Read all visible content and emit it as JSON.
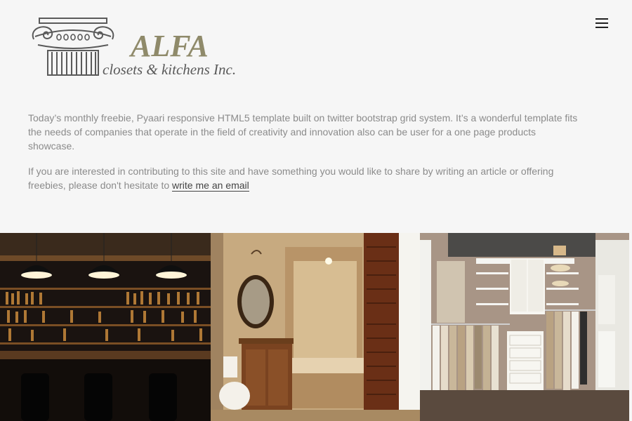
{
  "header": {
    "logo": {
      "brand": "ALFA",
      "tagline": "closets & kitchens Inc.",
      "icon": "ionic-column-icon"
    },
    "menu_icon": "hamburger-menu-icon"
  },
  "intro": {
    "paragraph1": "Today’s monthly freebie, Pyaari responsive HTML5 template built on twitter bootstrap grid system. It’s a wonderful template fits the needs of companies that operate in the field of creativity and innovation also can be user for a one page products showcase.",
    "paragraph2_text": "If you are interested in contributing to this site and have something you would like to share by writing an article or offering freebies, please don't hesitate to ",
    "paragraph2_link": "write me an email"
  },
  "gallery": {
    "photos": [
      {
        "subject": "bar-with-pendant-lights"
      },
      {
        "subject": "bathroom-with-mirror-and-shower"
      },
      {
        "subject": "walk-in-closet"
      }
    ]
  },
  "colors": {
    "background": "#f6f6f6",
    "text": "#8b8b8b",
    "link": "#444444",
    "brand": "#8f8a6a"
  }
}
